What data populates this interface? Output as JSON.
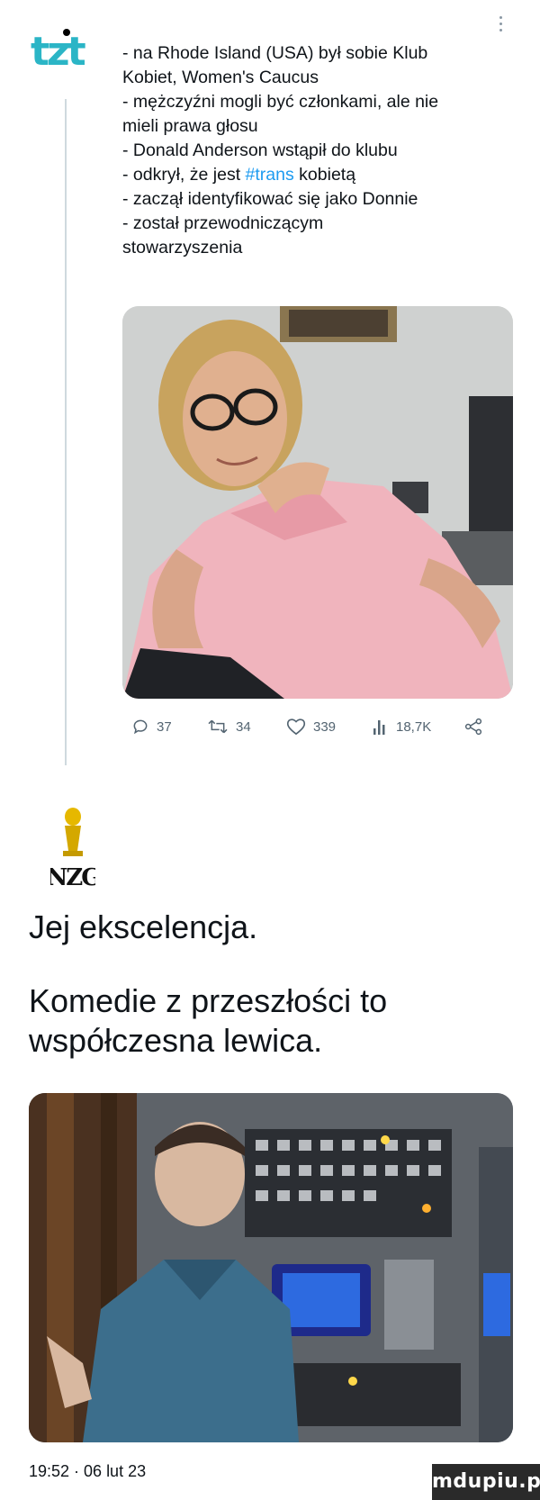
{
  "tweet": {
    "logo_text": "tzt",
    "lines": [
      "- na Rhode Island (USA) był sobie Klub",
      "Kobiet, Women's Caucus",
      "- mężczyźni mogli być członkami, ale nie",
      "mieli prawa głosu",
      "- Donald Anderson wstąpił do klubu"
    ],
    "line6_before": "- odkrył, że jest ",
    "hashtag": "#trans",
    "line6_after": " kobietą",
    "lines_after": [
      "- zaczął identyfikować się jako Donnie",
      "- został przewodniczącym",
      "stowarzyszenia"
    ],
    "actions": {
      "replies": "37",
      "retweets": "34",
      "likes": "339",
      "views": "18,7K"
    }
  },
  "reply": {
    "logo_text": "NZG",
    "paragraph1": "Jej ekscelencja.",
    "paragraph2_lines": [
      "Komedie z przeszłości to",
      "współczesna lewica."
    ],
    "timestamp": "19:52 · 06 lut 23"
  },
  "watermark": "mdupiu.pl",
  "colors": {
    "accent": "#1d9bf0",
    "logo": "#2bb5c6",
    "muted": "#536471"
  }
}
